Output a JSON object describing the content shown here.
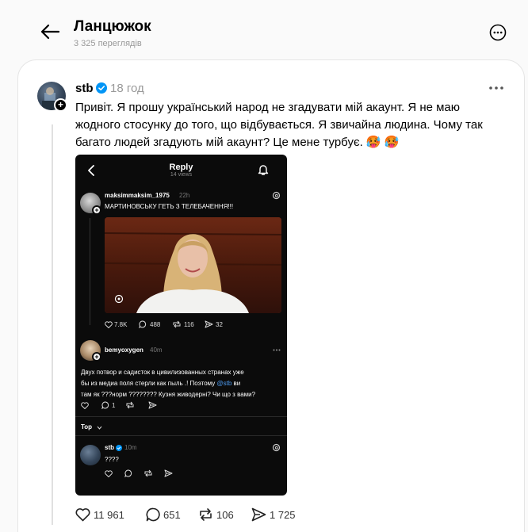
{
  "header": {
    "title": "Ланцюжок",
    "views": "3 325 переглядів"
  },
  "post": {
    "username": "stb",
    "time": "18 год",
    "text_lines": [
      "Привіт. Я прошу український народ не згадувати мій акаунт. Я не маю",
      "жодного стосунку до того, що відбувається. Я звичайна людина. Чому так",
      "багато людей згадують мій акаунт? Це мене турбує. 🥵 🥵"
    ],
    "stats": {
      "likes": "11 961",
      "comments": "651",
      "reposts": "106",
      "shares": "1 725"
    }
  },
  "screenshot": {
    "header_title": "Reply",
    "header_sub": "14 views",
    "reply1": {
      "username": "maksimmaksim_1975",
      "time": "22h",
      "text": "МАРТИНОВСЬКУ ГЕТЬ З ТЕЛЕБАЧЕННЯ!!!",
      "likes": "7.8K",
      "comments": "488",
      "reposts": "116",
      "shares": "32"
    },
    "reply2": {
      "username": "bemyoxygen",
      "time": "40m",
      "line1": "Двух потвор и садисток в цивилизованных странах уже",
      "line2_a": "бы из медиа поля стерли как пыль .! Поэтому ",
      "mention": "@stb",
      "line2_b": " ви",
      "line3": "там як ???норм ???????? Кузня живодерні? Чи що з вами?",
      "comments": "1"
    },
    "top_label": "Top",
    "reply3": {
      "username": "stb",
      "time": "10m",
      "text": "????"
    }
  },
  "colors": {
    "verified": "#0095f6",
    "mention": "#4d9bf0",
    "secondary_text": "#999999"
  }
}
